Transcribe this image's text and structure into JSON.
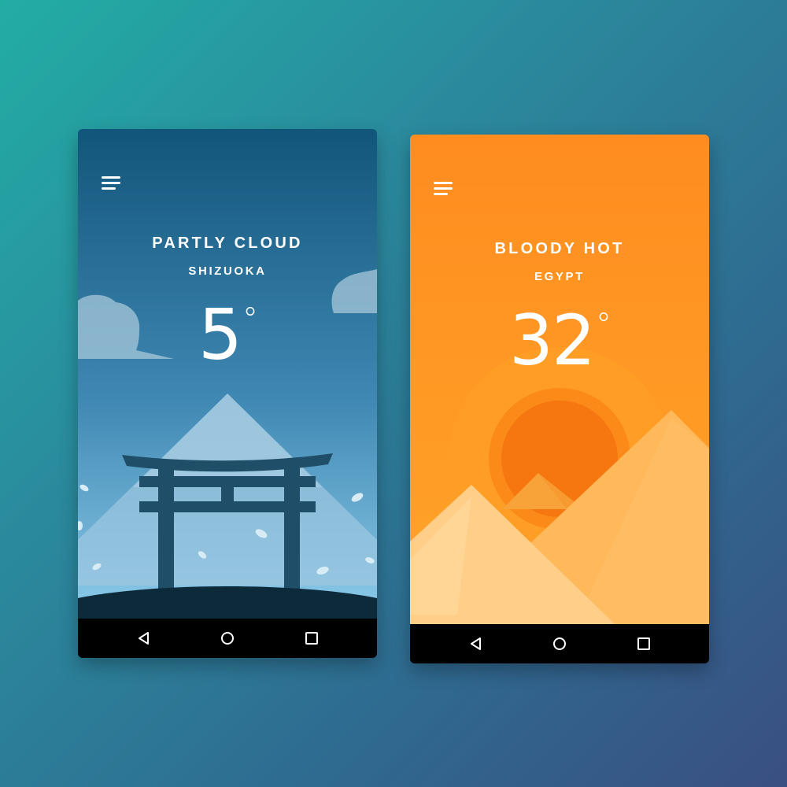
{
  "screens": [
    {
      "condition": "PARTLY CLOUD",
      "location": "SHIZUOKA",
      "temperature": "5",
      "degree_symbol": "°",
      "theme": {
        "top": "#12557a",
        "bottom": "#86c4e6",
        "accent": "#1f4e68"
      },
      "icons": [
        "menu-icon",
        "mountain",
        "torii-gate",
        "clouds",
        "petals"
      ]
    },
    {
      "condition": "BLOODY HOT",
      "location": "EGYPT",
      "temperature": "32",
      "degree_symbol": "°",
      "theme": {
        "top": "#ff8c1f",
        "bottom": "#ffa529",
        "accent": "#f07a12"
      },
      "icons": [
        "menu-icon",
        "sun",
        "pyramids"
      ]
    }
  ],
  "navbar": {
    "icons": [
      "back-icon",
      "home-icon",
      "recent-apps-icon"
    ],
    "color": "#000000"
  }
}
